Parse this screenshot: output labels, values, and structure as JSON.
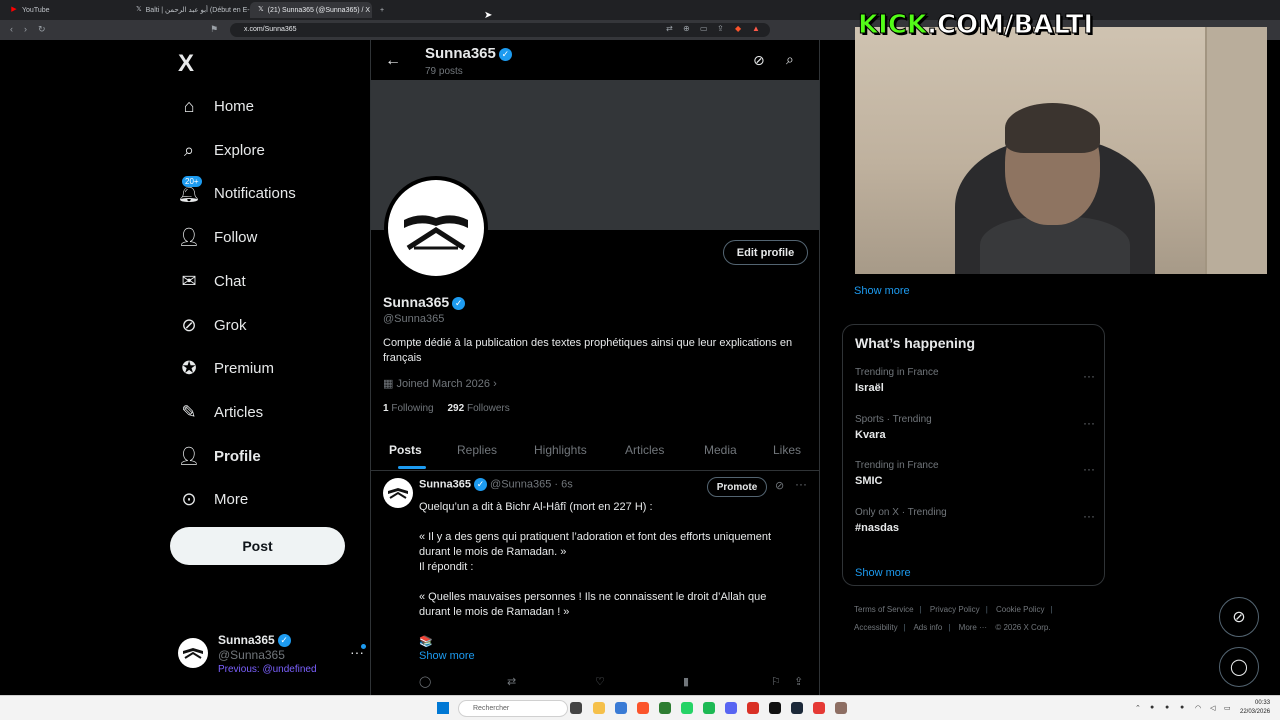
{
  "browser": {
    "tabs": [
      {
        "label": "YouTube",
        "icon": "youtube-icon",
        "active": false
      },
      {
        "label": "Balti | أبو عبد الرحمن (Début en E-COM",
        "icon": "x-icon",
        "active": false
      },
      {
        "label": "(21) Sunna365 (@Sunna365) / X",
        "icon": "x-icon",
        "active": true
      }
    ],
    "url": "x.com/Sunna365"
  },
  "nav": {
    "logo": "X",
    "items": [
      {
        "label": "Home",
        "icon": "home-icon"
      },
      {
        "label": "Explore",
        "icon": "search-icon"
      },
      {
        "label": "Notifications",
        "icon": "bell-icon",
        "badge": "20+"
      },
      {
        "label": "Follow",
        "icon": "add-person-icon"
      },
      {
        "label": "Chat",
        "icon": "mail-icon"
      },
      {
        "label": "Grok",
        "icon": "grok-icon"
      },
      {
        "label": "Premium",
        "icon": "premium-icon"
      },
      {
        "label": "Articles",
        "icon": "articles-icon"
      },
      {
        "label": "Profile",
        "icon": "person-icon"
      },
      {
        "label": "More",
        "icon": "more-icon"
      }
    ],
    "post_label": "Post",
    "account": {
      "name": "Sunna365",
      "handle": "@Sunna365",
      "previous": "Previous: @undefined"
    }
  },
  "profile": {
    "top_name": "Sunna365",
    "posts_count": "79 posts",
    "edit_label": "Edit profile",
    "name": "Sunna365",
    "handle": "@Sunna365",
    "bio": "Compte dédié à la publication des textes prophétiques ainsi que leur explications en français",
    "joined": "Joined March 2026",
    "following_count": "1",
    "following_label": "Following",
    "followers_count": "292",
    "followers_label": "Followers",
    "tabs": [
      "Posts",
      "Replies",
      "Highlights",
      "Articles",
      "Media",
      "Likes"
    ]
  },
  "tweet": {
    "name": "Sunna365",
    "meta": "@Sunna365 · 6s",
    "promote_label": "Promote",
    "lines": [
      "Quelqu’un a dit à Bichr Al-Hâfî (mort en 227 H) :",
      "",
      "« Il y a des gens qui pratiquent l’adoration et font des efforts uniquement",
      "durant le mois de Ramadan. »",
      "Il répondit :",
      "",
      "« Quelles mauvaises personnes ! Ils ne connaissent le droit d’Allah que",
      "durant le mois de Ramadan ! »",
      "",
      "📚"
    ],
    "show_more": "Show more"
  },
  "right": {
    "show_more_top": "Show more",
    "whats_happening": "What’s happening",
    "trends": [
      {
        "context": "Trending in France",
        "title": "Israël"
      },
      {
        "context": "Sports · Trending",
        "title": "Kvara"
      },
      {
        "context": "Trending in France",
        "title": "SMIC"
      },
      {
        "context": "Only on X · Trending",
        "title": "#nasdas"
      }
    ],
    "show_more": "Show more",
    "footer": [
      "Terms of Service",
      "Privacy Policy",
      "Cookie Policy",
      "Accessibility",
      "Ads info",
      "More ···",
      "© 2026 X Corp."
    ]
  },
  "overlay": {
    "kick_prefix": "KICK",
    "kick_suffix": ".COM/BALTI"
  },
  "taskbar": {
    "search_placeholder": "Rechercher",
    "time": "00:33",
    "date": "22/03/2026"
  },
  "colors": {
    "accent": "#1d9bf0",
    "kick_green": "#53fc18"
  }
}
